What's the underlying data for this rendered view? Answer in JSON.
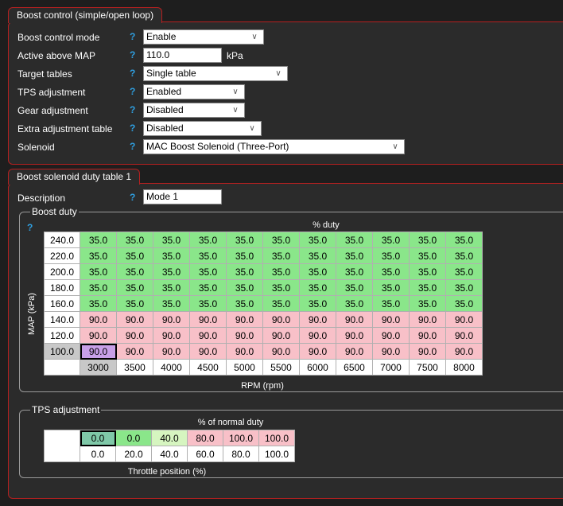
{
  "boost_control": {
    "title": "Boost control (simple/open loop)",
    "fields": [
      {
        "label": "Boost control mode",
        "value": "Enable",
        "type": "select"
      },
      {
        "label": "Active above MAP",
        "value": "110.0",
        "type": "text",
        "unit": "kPa"
      },
      {
        "label": "Target tables",
        "value": "Single table",
        "type": "select"
      },
      {
        "label": "TPS adjustment",
        "value": "Enabled",
        "type": "select"
      },
      {
        "label": "Gear adjustment",
        "value": "Disabled",
        "type": "select"
      },
      {
        "label": "Extra adjustment table",
        "value": "Disabled",
        "type": "select"
      },
      {
        "label": "Solenoid",
        "value": "MAC Boost Solenoid (Three-Port)",
        "type": "select"
      }
    ],
    "help": "?"
  },
  "duty_table": {
    "title": "Boost solenoid duty table 1",
    "description_label": "Description",
    "description_value": "Mode 1",
    "boost_duty_group": "Boost duty",
    "top_label": "% duty",
    "y_label": "MAP (kPa)",
    "x_label": "RPM (rpm)",
    "map_axis": [
      "240.0",
      "220.0",
      "200.0",
      "180.0",
      "160.0",
      "140.0",
      "120.0",
      "100.0"
    ],
    "rpm_axis": [
      "3000",
      "3500",
      "4000",
      "4500",
      "5000",
      "5500",
      "6000",
      "6500",
      "7000",
      "7500",
      "8000"
    ],
    "rows": [
      [
        "35.0",
        "35.0",
        "35.0",
        "35.0",
        "35.0",
        "35.0",
        "35.0",
        "35.0",
        "35.0",
        "35.0",
        "35.0"
      ],
      [
        "35.0",
        "35.0",
        "35.0",
        "35.0",
        "35.0",
        "35.0",
        "35.0",
        "35.0",
        "35.0",
        "35.0",
        "35.0"
      ],
      [
        "35.0",
        "35.0",
        "35.0",
        "35.0",
        "35.0",
        "35.0",
        "35.0",
        "35.0",
        "35.0",
        "35.0",
        "35.0"
      ],
      [
        "35.0",
        "35.0",
        "35.0",
        "35.0",
        "35.0",
        "35.0",
        "35.0",
        "35.0",
        "35.0",
        "35.0",
        "35.0"
      ],
      [
        "35.0",
        "35.0",
        "35.0",
        "35.0",
        "35.0",
        "35.0",
        "35.0",
        "35.0",
        "35.0",
        "35.0",
        "35.0"
      ],
      [
        "90.0",
        "90.0",
        "90.0",
        "90.0",
        "90.0",
        "90.0",
        "90.0",
        "90.0",
        "90.0",
        "90.0",
        "90.0"
      ],
      [
        "90.0",
        "90.0",
        "90.0",
        "90.0",
        "90.0",
        "90.0",
        "90.0",
        "90.0",
        "90.0",
        "90.0",
        "90.0"
      ],
      [
        "90.0",
        "90.0",
        "90.0",
        "90.0",
        "90.0",
        "90.0",
        "90.0",
        "90.0",
        "90.0",
        "90.0",
        "90.0"
      ]
    ]
  },
  "tps_adjustment": {
    "title": "TPS adjustment",
    "top_label": "% of normal duty",
    "x_label": "Throttle position (%)",
    "values": [
      "0.0",
      "0.0",
      "40.0",
      "80.0",
      "100.0",
      "100.0"
    ],
    "axis": [
      "0.0",
      "20.0",
      "40.0",
      "60.0",
      "80.0",
      "100.0"
    ]
  },
  "colors": {
    "panel_border": "#b52020",
    "green_cell": "#8ae68a",
    "pink_cell": "#f8c0c8",
    "selected_cell": "#c8a0e8",
    "help": "#2f9fe0"
  }
}
